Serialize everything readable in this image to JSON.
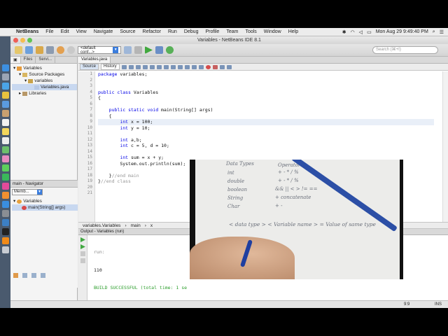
{
  "menubar": {
    "app": "NetBeans",
    "menus": [
      "File",
      "Edit",
      "View",
      "Navigate",
      "Source",
      "Refactor",
      "Run",
      "Debug",
      "Profile",
      "Team",
      "Tools",
      "Window",
      "Help"
    ],
    "clock": "Mon Aug 29  9:49:40 PM"
  },
  "window": {
    "title": "Variables - NetBeans IDE 8.1"
  },
  "toolbar": {
    "config_value": "<default conf...>",
    "search_placeholder": "Search (⌘+I)"
  },
  "projects": {
    "tabs": [
      "Files",
      "Servi..."
    ],
    "tree": [
      {
        "label": "Variables",
        "level": 0
      },
      {
        "label": "Source Packages",
        "level": 1
      },
      {
        "label": "variables",
        "level": 2
      },
      {
        "label": "Variables.java",
        "level": 3,
        "selected": true
      },
      {
        "label": "Libraries",
        "level": 1
      }
    ]
  },
  "navigator": {
    "title": "main - Navigator",
    "filter": "Memb...",
    "items": [
      "Variables",
      "main(String[] args)"
    ]
  },
  "editor": {
    "tab": "Variables.java",
    "source_btn": "Source",
    "history_btn": "History",
    "line_numbers": [
      "1",
      "2",
      "3",
      "4",
      "5",
      "6",
      "7",
      "8",
      "9",
      "10",
      "11",
      "12",
      "13",
      "14",
      "15",
      "16",
      "17",
      "18",
      "19",
      "20",
      "21"
    ],
    "lines": [
      "package variables;",
      "",
      "",
      "public class Variables",
      "{",
      "",
      "    public static void main(String[] args)",
      "    {",
      "        int x = 100;",
      "        int y = 10;",
      "",
      "        int a,b;",
      "        int c = 5, d = 10;",
      "",
      "        int sum = x + y;",
      "        System.out.println(sum);",
      "",
      "    }//end main",
      "}//end class",
      "",
      ""
    ]
  },
  "breadcrumbs": [
    "variables.Variables",
    "main",
    "x"
  ],
  "output": {
    "title": "Output - Variables (run)",
    "lines": [
      "run:",
      "110",
      "BUILD SUCCESSFUL (total time: 1 se"
    ]
  },
  "status": {
    "position": "9:9",
    "mode": "INS"
  },
  "video_notes": {
    "col1_header": "Data Types",
    "col2_header": "Operators",
    "types": [
      "int",
      "double",
      "boolean",
      "String",
      "Char"
    ],
    "ops": [
      "+ - * / %",
      "+ - * / %",
      "&& || < > != ==",
      "+ concatenate",
      "+ -"
    ],
    "syntax": "< data type >  < Variable name >  =  Value of same type"
  }
}
